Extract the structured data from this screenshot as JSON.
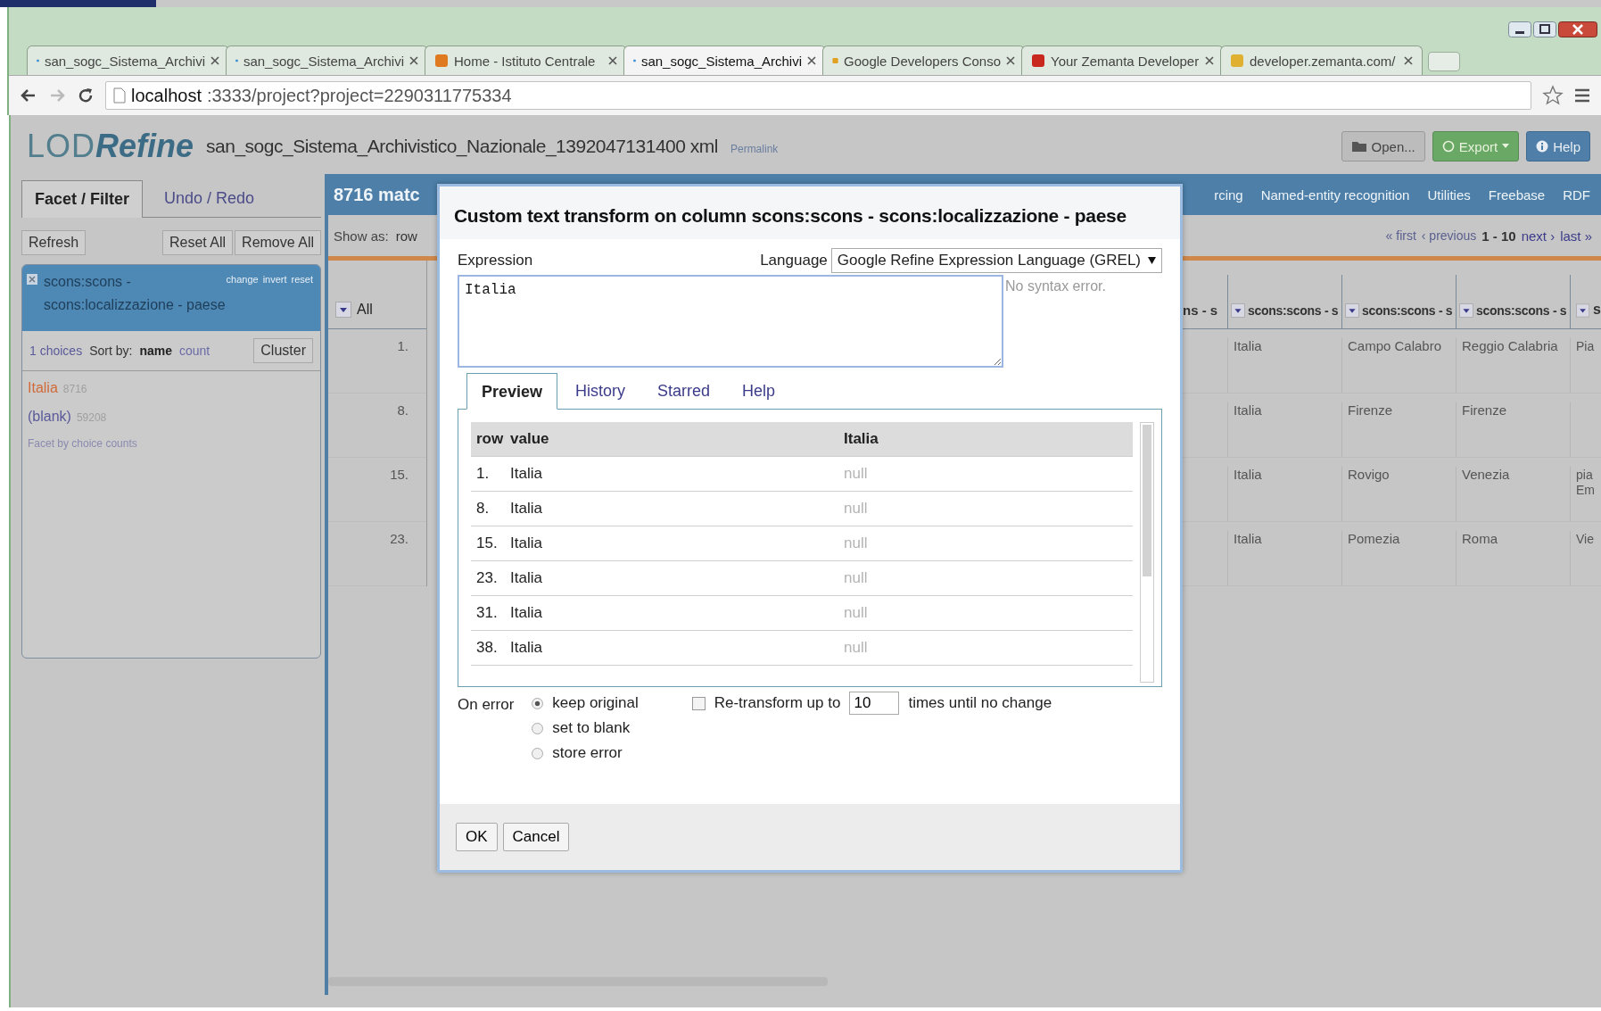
{
  "browser": {
    "tabs": [
      {
        "label": "san_sogc_Sistema_Archivi",
        "kind": "drop",
        "selected": false
      },
      {
        "label": "san_sogc_Sistema_Archivi",
        "kind": "drop",
        "selected": false
      },
      {
        "label": "Home - Istituto Centrale",
        "kind": "pencil",
        "selected": false
      },
      {
        "label": "san_sogc_Sistema_Archivi",
        "kind": "drop",
        "selected": true
      },
      {
        "label": "Google Developers Conso",
        "kind": "brackets",
        "selected": false
      },
      {
        "label": "Your Zemanta Developer",
        "kind": "mail",
        "selected": false
      },
      {
        "label": "developer.zemanta.com/",
        "kind": "page",
        "selected": false
      }
    ],
    "address": {
      "host": "localhost",
      "path": ":3333/project?project=2290311775334"
    }
  },
  "app": {
    "logo": {
      "prefix": "LOD",
      "name": "Refine"
    },
    "project_name": "san_sogc_Sistema_Archivistico_Nazionale_1392047131400 xml",
    "permalink": "Permalink",
    "header_buttons": [
      {
        "label": "Open...",
        "kind": "open"
      },
      {
        "label": "Export",
        "kind": "export"
      },
      {
        "label": "Help",
        "kind": "help"
      }
    ]
  },
  "left_panel": {
    "tabs": [
      {
        "label": "Facet / Filter",
        "selected": true
      },
      {
        "label": "Undo / Redo",
        "selected": false
      }
    ],
    "refresh": "Refresh",
    "reset_all": "Reset All",
    "remove_all": "Remove All",
    "facet": {
      "title_lines": [
        "scons:scons -",
        "scons:localizzazione - paese"
      ],
      "actions": [
        "change",
        "invert",
        "reset"
      ],
      "choices_count": "1 choices",
      "sort_label": "Sort by:",
      "sort_options": [
        {
          "label": "name",
          "selected": true
        },
        {
          "label": "count",
          "selected": false
        }
      ],
      "cluster": "Cluster",
      "choices": [
        {
          "label": "Italia",
          "count": "8716",
          "selected": true
        },
        {
          "label": "(blank)",
          "count": "59208",
          "selected": false
        }
      ],
      "footer_link": "Facet by choice counts"
    }
  },
  "main": {
    "matches": "8716 matc",
    "menu": [
      "rcing",
      "Named-entity recognition",
      "Utilities",
      "Freebase",
      "RDF"
    ],
    "show_as": "Show as:",
    "show_as_value": "row",
    "pager": {
      "first": "« first",
      "previous": "‹ previous",
      "range": "1 - 10",
      "next": "next ›",
      "last": "last »"
    },
    "all_column": "All",
    "cut_column": "ns - s",
    "columns": [
      "scons:scons - s",
      "scons:scons - s",
      "scons:scons - s",
      "s"
    ],
    "rows": [
      {
        "row": "1.",
        "cells": [
          "Italia",
          "Campo Calabro",
          "Reggio Calabria",
          "Pia"
        ]
      },
      {
        "row": "8.",
        "cells": [
          "Italia",
          "Firenze",
          "Firenze"
        ]
      },
      {
        "row": "15.",
        "cells": [
          "Italia",
          "Rovigo",
          "Venezia",
          "pia Em"
        ]
      },
      {
        "row": "23.",
        "cells": [
          "Italia",
          "Pomezia",
          "Roma",
          "Vie"
        ]
      }
    ]
  },
  "dialog": {
    "title": "Custom text transform on column scons:scons - scons:localizzazione - paese",
    "expression_label": "Expression",
    "language_label": "Language",
    "language": "Google Refine Expression Language (GREL)",
    "expression": "Italia",
    "syntax_status": "No syntax error.",
    "tabs": [
      {
        "label": "Preview",
        "selected": true
      },
      {
        "label": "History",
        "selected": false
      },
      {
        "label": "Starred",
        "selected": false
      },
      {
        "label": "Help",
        "selected": false
      }
    ],
    "preview_columns": [
      "row",
      "value",
      "Italia"
    ],
    "preview_rows": [
      {
        "row": "1.",
        "value": "Italia",
        "result": "null"
      },
      {
        "row": "8.",
        "value": "Italia",
        "result": "null"
      },
      {
        "row": "15.",
        "value": "Italia",
        "result": "null"
      },
      {
        "row": "23.",
        "value": "Italia",
        "result": "null"
      },
      {
        "row": "31.",
        "value": "Italia",
        "result": "null"
      },
      {
        "row": "38.",
        "value": "Italia",
        "result": "null"
      }
    ],
    "on_error_label": "On error",
    "on_error_options": [
      {
        "label": "keep original",
        "selected": true
      },
      {
        "label": "set to blank",
        "selected": false
      },
      {
        "label": "store error",
        "selected": false
      }
    ],
    "retransform": {
      "label": "Re-transform up to",
      "checked": false,
      "value": "10",
      "suffix": "times until no change"
    },
    "buttons": [
      "OK",
      "Cancel"
    ]
  }
}
